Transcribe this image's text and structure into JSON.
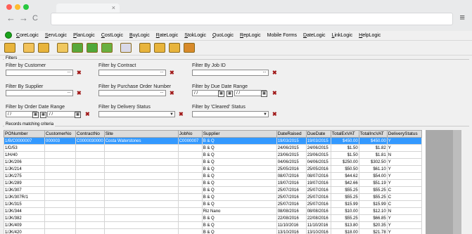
{
  "browser": {
    "dots": [
      "#ff5f57",
      "#febc2e",
      "#28c840"
    ],
    "tab_close": "×",
    "back": "←",
    "forward": "→",
    "reload": "C",
    "menu": "≡"
  },
  "menubar": {
    "items": [
      {
        "u": "C",
        "rest": "oreLogic"
      },
      {
        "u": "S",
        "rest": "ervLogic"
      },
      {
        "u": "P",
        "rest": "lanLogic"
      },
      {
        "u": "C",
        "rest": "ostLogic"
      },
      {
        "u": "B",
        "rest": "uyLogic"
      },
      {
        "u": "R",
        "rest": "ateLogic"
      },
      {
        "u": "S",
        "rest": "tokLogic"
      },
      {
        "u": "Q",
        "rest": "uoLogic"
      },
      {
        "u": "R",
        "rest": "epLogic"
      },
      {
        "u": "",
        "rest": "Mobile Forms"
      },
      {
        "u": "D",
        "rest": "ateLogic"
      },
      {
        "u": "L",
        "rest": "inkLogic"
      },
      {
        "u": "H",
        "rest": "elpLogic"
      }
    ]
  },
  "toolbar": {
    "icons": [
      "new-icon",
      "open-icon",
      "folder-icon",
      "folder-search-icon",
      "refresh-icon",
      "recycle-icon",
      "refresh-green-icon",
      "window-icon",
      "folder-blue-icon",
      "folder-export-icon",
      "folder-edit-icon",
      "users-icon"
    ],
    "colors": [
      "#e8b43c",
      "#f2c25a",
      "#e8b43c",
      "#f0c860",
      "#59a83a",
      "#4fa83a",
      "#6ab040",
      "#d9d9e8",
      "#e8b43c",
      "#e8b43c",
      "#e8b43c",
      "#d88a2a"
    ]
  },
  "filters": {
    "group_label": "Filters",
    "customer": {
      "label": "Filter by Customer",
      "value": ""
    },
    "contract": {
      "label": "Filter by Contract",
      "value": ""
    },
    "job_id": {
      "label": "Filter By Job ID",
      "value": ""
    },
    "supplier": {
      "label": "Filter By Supplier",
      "value": ""
    },
    "po_number": {
      "label": "Filter by Purchase Order Number",
      "value": ""
    },
    "due_date": {
      "label": "Filter by Due Date Range",
      "from": "/ /",
      "to": "/ /"
    },
    "order_date": {
      "label": "Filter by Order Date Range",
      "from": "/ /",
      "to": "/ /"
    },
    "delivery_status": {
      "label": "Filter by Delivery Status",
      "value": ""
    },
    "cleared_status": {
      "label": "Filter by 'Cleared' Status",
      "value": ""
    },
    "dots": "...",
    "clear": "✖",
    "cal": "▦",
    "arrow": "▼"
  },
  "records": {
    "group_label": "Records matching criteria",
    "columns": [
      "PONumber",
      "CustomerNo",
      "ContractNo",
      "Site",
      "JobNo",
      "Supplier",
      "DateRaised",
      "DueDate",
      "TotalExVAT",
      "TotalIncVAT",
      "DeliveryStatus"
    ],
    "rows": [
      [
        "1/B/C0000007",
        "000003",
        "C0000030000",
        "Costa Waterstones",
        "C0000007",
        "B & Q",
        "19/03/2015",
        "19/03/2015",
        "$450.00",
        "$450.00",
        "Y"
      ],
      [
        "1/D/53",
        "",
        "",
        "",
        "",
        "B & Q",
        "24/06/2015",
        "24/06/2015",
        "$1.50",
        "$1.82",
        "Y"
      ],
      [
        "1/H/40",
        "",
        "",
        "",
        "",
        "B & Q",
        "23/06/2015",
        "23/06/2015",
        "$1.50",
        "$1.81",
        "N"
      ],
      [
        "1/JK/206",
        "",
        "",
        "",
        "",
        "B & Q",
        "04/06/2015",
        "04/06/2015",
        "$250.00",
        "$302.50",
        "Y"
      ],
      [
        "1/JK/214",
        "",
        "",
        "",
        "",
        "B & Q",
        "25/05/2016",
        "25/05/2016",
        "$50.50",
        "$61.10",
        "Y"
      ],
      [
        "1/JK/275",
        "",
        "",
        "",
        "",
        "B & Q",
        "08/07/2016",
        "08/07/2016",
        "$44.62",
        "$54.00",
        "Y"
      ],
      [
        "1/JK/289",
        "",
        "",
        "",
        "",
        "B & Q",
        "19/07/2016",
        "19/07/2016",
        "$42.66",
        "$51.19",
        "Y"
      ],
      [
        "1/JK/307",
        "",
        "",
        "",
        "",
        "B & Q",
        "25/07/2016",
        "25/07/2016",
        "$55.25",
        "$55.25",
        "C"
      ],
      [
        "1/JK/307R/1",
        "",
        "",
        "",
        "",
        "B & Q",
        "25/07/2016",
        "25/07/2016",
        "$55.25",
        "$55.25",
        "C"
      ],
      [
        "1/JK/315",
        "",
        "",
        "",
        "",
        "B & Q",
        "25/07/2016",
        "25/07/2016",
        "$15.99",
        "$15.99",
        "C"
      ],
      [
        "1/JK/344",
        "",
        "",
        "",
        "",
        "Riz Nano",
        "08/08/2016",
        "08/08/2016",
        "$10.00",
        "$12.10",
        "N"
      ],
      [
        "1/JK/382",
        "",
        "",
        "",
        "",
        "B & Q",
        "22/08/2016",
        "22/08/2016",
        "$55.25",
        "$66.85",
        "Y"
      ],
      [
        "1/JK/409",
        "",
        "",
        "",
        "",
        "B & Q",
        "11/10/2016",
        "11/10/2016",
        "$13.80",
        "$20.35",
        "Y"
      ],
      [
        "1/JK/420",
        "",
        "",
        "",
        "",
        "B & Q",
        "13/10/2016",
        "13/10/2016",
        "$18.00",
        "$21.78",
        "Y"
      ]
    ]
  }
}
